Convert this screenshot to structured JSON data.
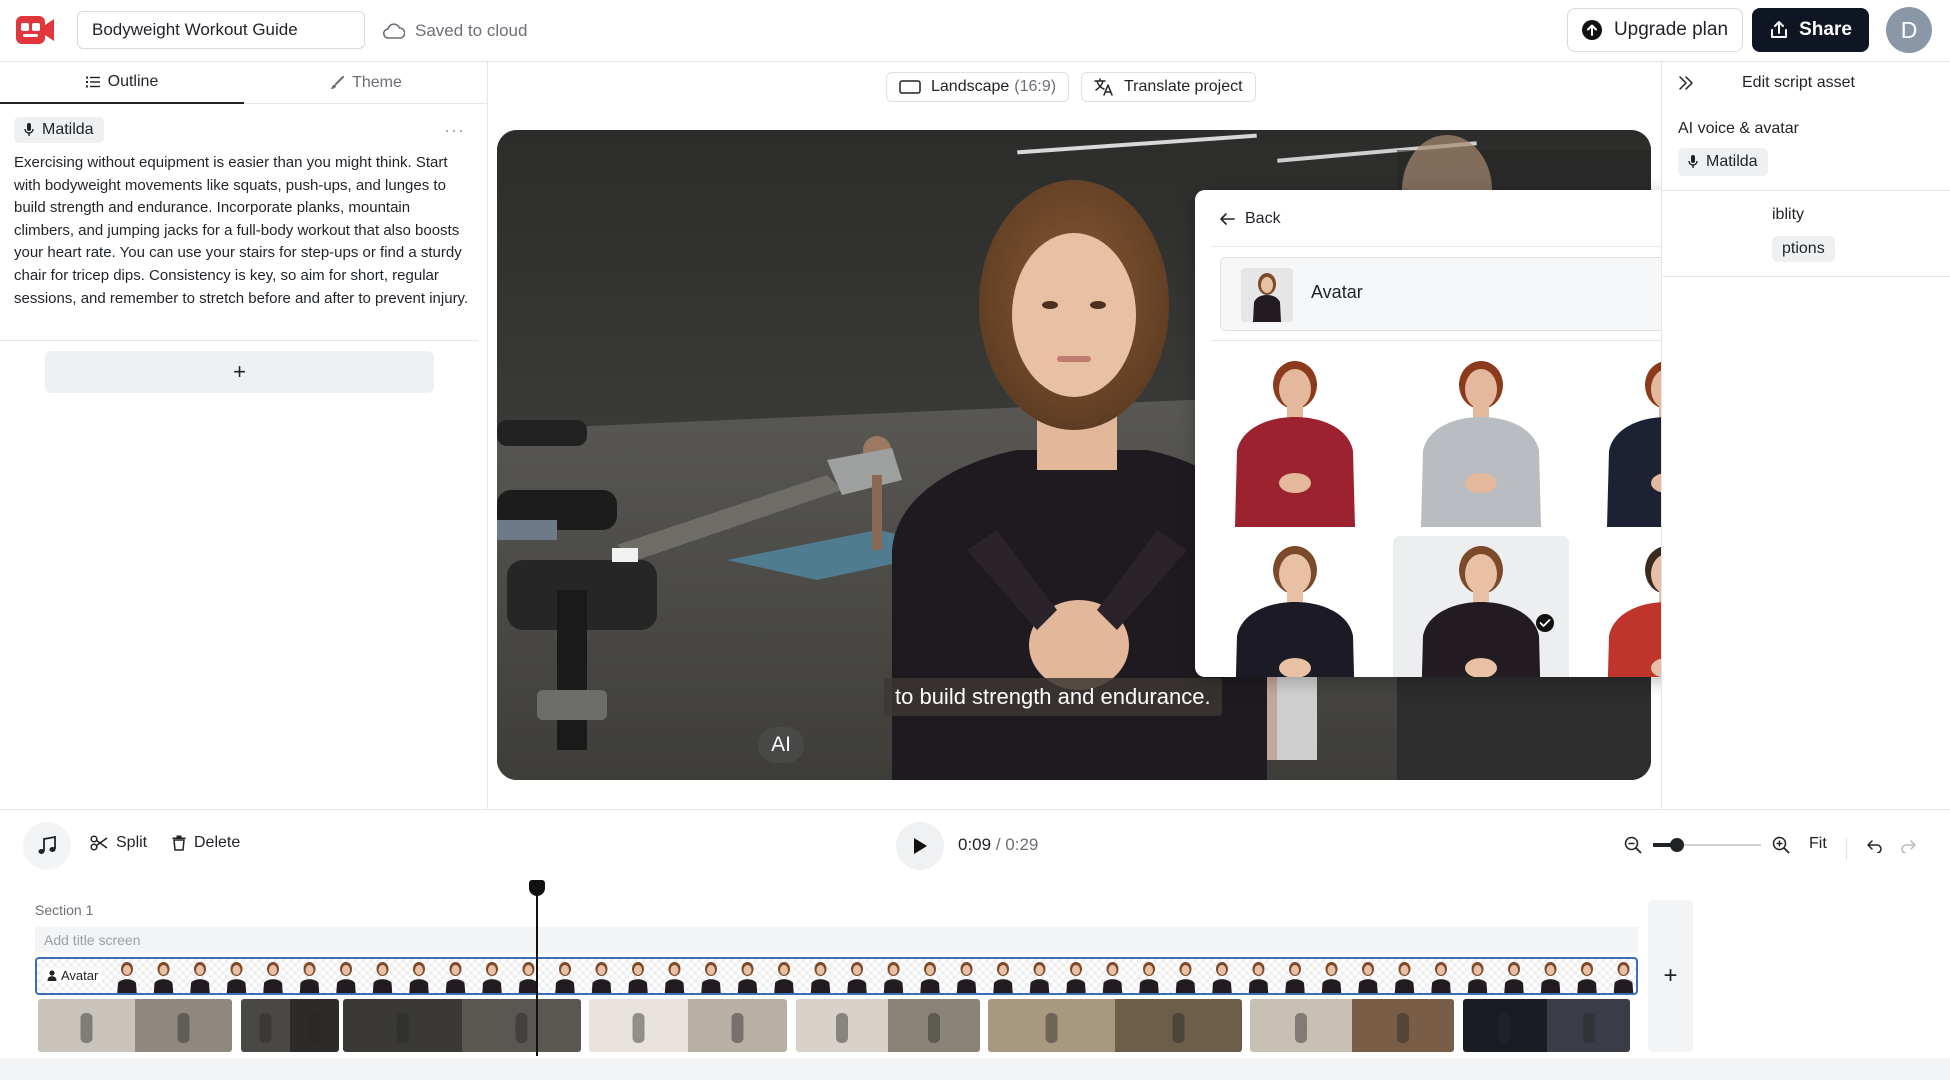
{
  "header": {
    "project_title": "Bodyweight Workout Guide",
    "save_status": "Saved to cloud",
    "upgrade_label": "Upgrade plan",
    "share_label": "Share",
    "user_initial": "D",
    "brand_color": "#e0363c"
  },
  "left_panel": {
    "tabs": [
      {
        "label": "Outline",
        "icon": "list-icon",
        "active": true
      },
      {
        "label": "Theme",
        "icon": "brush-icon",
        "active": false
      }
    ],
    "voice_name": "Matilda",
    "more_label": "···",
    "script": "Exercising without equipment is easier than you might think. Start with bodyweight movements like squats, push-ups, and lunges to build strength and endurance. Incorporate planks, mountain climbers, and jumping jacks for a full-body workout that also boosts your heart rate. You can use your stairs for step-ups or find a sturdy chair for tricep dips. Consistency is key, so aim for short, regular sessions, and remember to stretch before and after to prevent injury.",
    "add_scene_label": "+"
  },
  "canvas": {
    "aspect_label": "Landscape",
    "aspect_ratio": "(16:9)",
    "translate_label": "Translate project",
    "subtitle": "to build strength and endurance.",
    "ai_badge": "AI"
  },
  "avatar_popover": {
    "back_label": "Back",
    "current_label": "Avatar",
    "avatars": [
      {
        "top": "#9d2230",
        "skin": "#e3b89c",
        "hair": "#8b3a1c",
        "selected": false
      },
      {
        "top": "#b9bcc0",
        "skin": "#e3b89c",
        "hair": "#8b3a1c",
        "selected": false
      },
      {
        "top": "#1c2233",
        "skin": "#e3b89c",
        "hair": "#8b3a1c",
        "selected": false
      },
      {
        "top": "#1c1a25",
        "skin": "#e8c1a4",
        "hair": "#7a4a2a",
        "selected": false
      },
      {
        "top": "#231b22",
        "skin": "#e8c1a4",
        "hair": "#7a4a2a",
        "selected": true
      },
      {
        "top": "#c0352b",
        "skin": "#e6bfa6",
        "hair": "#3a2a20",
        "selected": false
      }
    ]
  },
  "right_panel": {
    "title": "Edit script asset",
    "voice_section_label": "AI voice & avatar",
    "voice_name": "Matilda",
    "visibility_label": "iblity",
    "options_label": "ptions"
  },
  "timeline_controls": {
    "split_label": "Split",
    "delete_label": "Delete",
    "current_time": "0:09",
    "total_time": "/ 0:29",
    "zoom_level": 0.22,
    "fit_label": "Fit"
  },
  "timeline": {
    "section_label": "Section 1",
    "title_screen_placeholder": "Add title screen",
    "avatar_track_label": "Avatar",
    "add_track_label": "+",
    "clips": [
      {
        "tone1": "#c9c4bb",
        "tone2": "#8f887e"
      },
      {
        "tone1": "#4a4845",
        "tone2": "#2c2b29"
      },
      {
        "tone1": "#3a3936",
        "tone2": "#5a5752"
      },
      {
        "tone1": "#e8e3dc",
        "tone2": "#b8b0a4"
      },
      {
        "tone1": "#d8d2ca",
        "tone2": "#8a8378"
      },
      {
        "tone1": "#a89880",
        "tone2": "#6d5e49"
      },
      {
        "tone1": "#c8c0b3",
        "tone2": "#7a5d47"
      },
      {
        "tone1": "#1a1c24",
        "tone2": "#3a3c48"
      }
    ]
  }
}
